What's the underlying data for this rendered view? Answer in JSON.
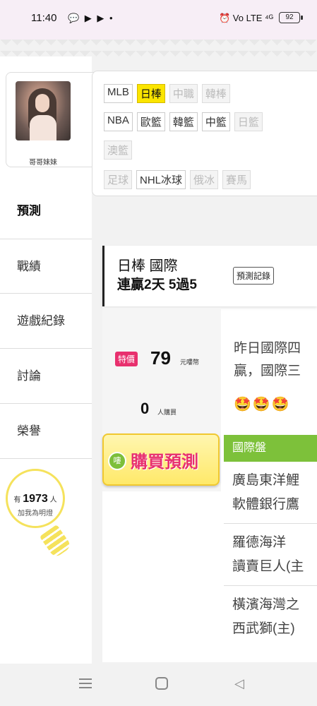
{
  "status": {
    "time": "11:40",
    "left_icons": "💬 ▶ ▶ •",
    "right_icons": "⏰ Vo LTE ⁴ᴳ",
    "battery": "92"
  },
  "profile": {
    "name": "哥哥妹妹"
  },
  "sidebar": {
    "items": [
      {
        "label": "預測"
      },
      {
        "label": "戰績"
      },
      {
        "label": "遊戲紀錄"
      },
      {
        "label": "討論"
      },
      {
        "label": "榮譽"
      }
    ],
    "bulb": {
      "prefix": "有",
      "count": "1973",
      "suffix": "人",
      "sub": "加我為明燈"
    }
  },
  "tags": {
    "row1": [
      "MLB",
      "日棒",
      "中職",
      "韓棒"
    ],
    "row2": [
      "NBA",
      "歐籃",
      "韓籃",
      "中籃",
      "日籃"
    ],
    "row3": [
      "澳籃"
    ],
    "row4": [
      "足球",
      "NHL冰球",
      "俄冰",
      "賽馬"
    ]
  },
  "game": {
    "title": "日棒 國際",
    "streak": "連贏2天 5過5",
    "record_button": "預測記錄"
  },
  "price": {
    "special": "特價",
    "amount": "79",
    "unit": "元嘍幣",
    "buyers": "0",
    "buyers_unit": "人購買"
  },
  "buy_button": {
    "icon": "嘍",
    "label": "購買預測"
  },
  "description": {
    "line1": "昨日國際四",
    "line2": "贏，國際三",
    "emojis": "🤩🤩🤩"
  },
  "picks": {
    "header": "國際盤",
    "items": [
      {
        "line1": "廣島東洋鯉",
        "line2": "軟體銀行鷹"
      },
      {
        "line1": "羅德海洋",
        "line2": "讀賣巨人(主"
      },
      {
        "line1": "橫濱海灣之",
        "line2": "西武獅(主)"
      }
    ]
  }
}
